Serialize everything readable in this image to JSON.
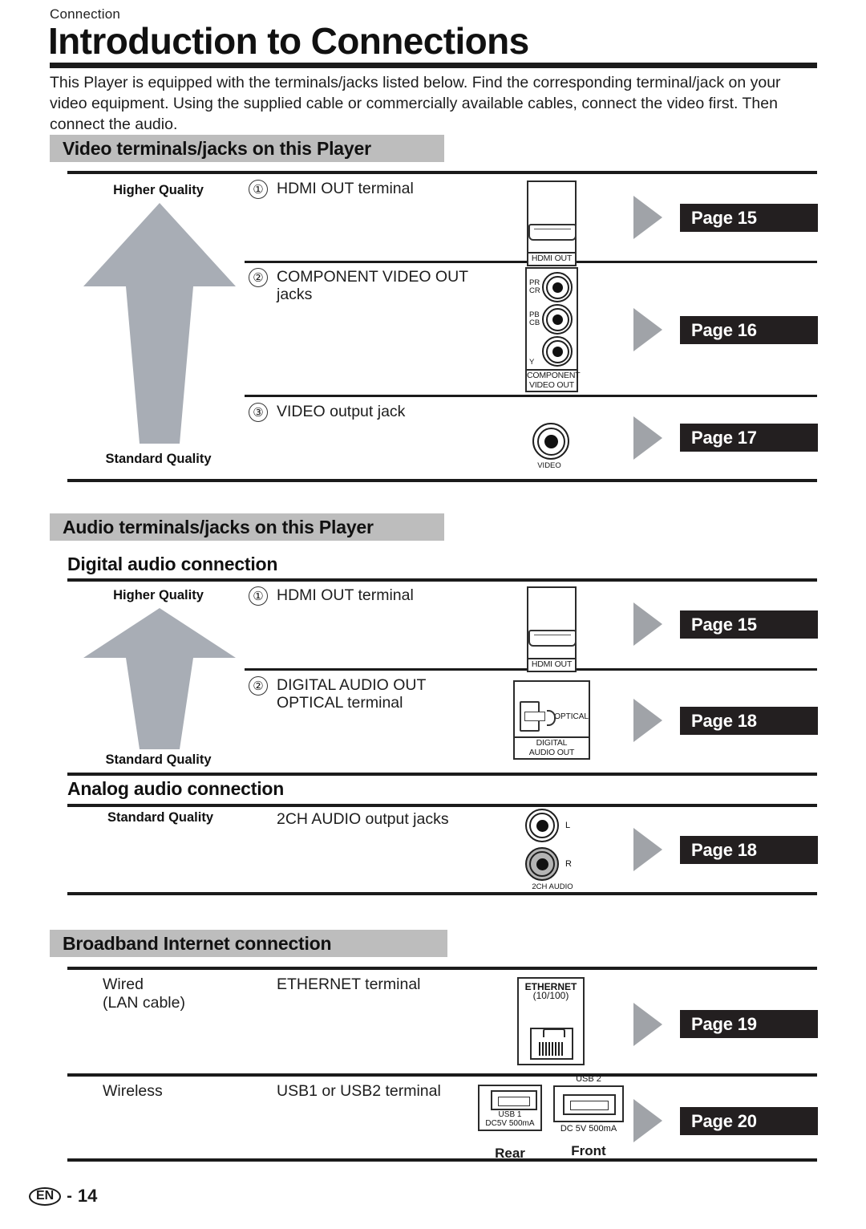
{
  "header": {
    "kicker": "Connection",
    "title": "Introduction to Connections",
    "intro": "This Player is equipped with the terminals/jacks listed below. Find the corresponding terminal/jack on your video equipment. Using the supplied cable or commercially available cables, connect the video first. Then connect the audio."
  },
  "sections": {
    "video": {
      "banner": "Video terminals/jacks on this Player",
      "higher_quality": "Higher Quality",
      "standard_quality": "Standard Quality",
      "rows": [
        {
          "num": "①",
          "label": "HDMI OUT terminal",
          "page": "Page 15"
        },
        {
          "num": "②",
          "label_line1": "COMPONENT VIDEO OUT",
          "label_line2": "jacks",
          "page": "Page 16"
        },
        {
          "num": "③",
          "label": "VIDEO output jack",
          "page": "Page 17"
        }
      ]
    },
    "audio": {
      "banner": "Audio terminals/jacks on this Player",
      "digital_head": "Digital audio connection",
      "analog_head": "Analog audio connection",
      "higher_quality": "Higher Quality",
      "standard_quality": "Standard Quality",
      "digital_rows": [
        {
          "num": "①",
          "label": "HDMI OUT terminal",
          "page": "Page 15"
        },
        {
          "num": "②",
          "label_line1": "DIGITAL AUDIO OUT",
          "label_line2": "OPTICAL terminal",
          "page": "Page 18"
        }
      ],
      "analog_rows": [
        {
          "quality": "Standard Quality",
          "label": "2CH AUDIO output jacks",
          "page": "Page 18"
        }
      ]
    },
    "broadband": {
      "banner": "Broadband Internet connection",
      "rows": [
        {
          "type_line1": "Wired",
          "type_line2": "(LAN cable)",
          "label": "ETHERNET terminal",
          "page": "Page 19"
        },
        {
          "type_line1": "Wireless",
          "type_line2": "",
          "label": "USB1 or USB2 terminal",
          "page": "Page 20"
        }
      ]
    }
  },
  "art_labels": {
    "hdmi_out": "HDMI OUT",
    "component_pr": "PR",
    "component_cr": "CR",
    "component_pb": "PB",
    "component_cb": "CB",
    "component_y": "Y",
    "component_caption_l1": "COMPONENT",
    "component_caption_l2": "VIDEO OUT",
    "video": "VIDEO",
    "optical": "OPTICAL",
    "digital_caption_l1": "DIGITAL",
    "digital_caption_l2": "AUDIO OUT",
    "audio_l": "L",
    "audio_r": "R",
    "audio_caption": "2CH AUDIO",
    "ethernet_l1": "ETHERNET",
    "ethernet_l2": "(10/100)",
    "usb1_l1": "USB 1",
    "usb1_l2": "DC5V 500mA",
    "usb2_top": "USB 2",
    "usb2_bottom": "DC 5V  500mA",
    "rear": "Rear",
    "front": "Front"
  },
  "footer": {
    "lang": "EN",
    "dash": "-",
    "page_number": "14"
  },
  "colors": {
    "banner_grey": "#bdbdbd",
    "arrow_grey": "#a8adb5",
    "chip_black": "#231f20",
    "triangle_grey": "#a0a3a8",
    "rule_black": "#1b1b1b"
  }
}
